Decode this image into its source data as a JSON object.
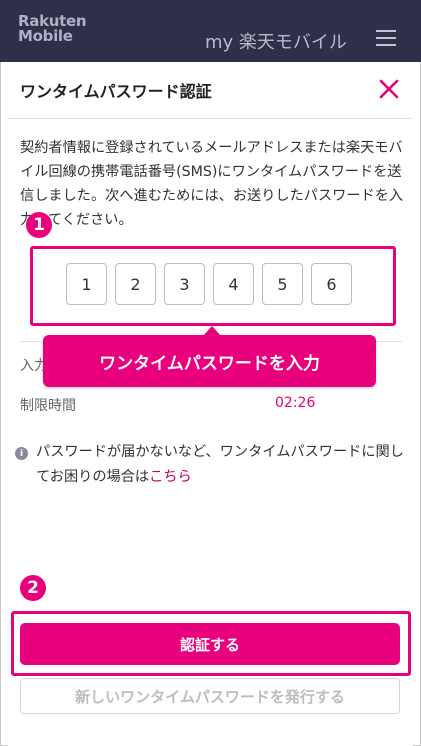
{
  "header": {
    "logo_line1": "Rakuten",
    "logo_line2": "Mobile",
    "my_rakuten": "my 楽天モバイル"
  },
  "modal": {
    "title": "ワンタイムパスワード認証",
    "description": "契約者情報に登録されているメールアドレスまたは楽天モバイル回線の携帯電話番号(SMS)にワンタイムパスワードを送信しました。次へ進むためには、お送りしたパスワードを入力してください。",
    "otp": [
      "1",
      "2",
      "3",
      "4",
      "5",
      "6"
    ],
    "input_label": "入力",
    "limit_label": "制限時間",
    "limit_value": "02:26",
    "tooltip": "ワンタイムパスワードを入力",
    "note_text": "パスワードが届かないなど、ワンタイムパスワードに関してお困りの場合は",
    "note_link": "こちら",
    "primary_button": "認証する",
    "secondary_button": "新しいワンタイムパスワードを発行する"
  },
  "markers": [
    "1",
    "2"
  ],
  "colors": {
    "accent": "#e8007d",
    "header_bg": "#2f2f49"
  },
  "icons": {
    "close": "close-icon",
    "info": "info-icon",
    "menu": "hamburger-menu-icon"
  }
}
